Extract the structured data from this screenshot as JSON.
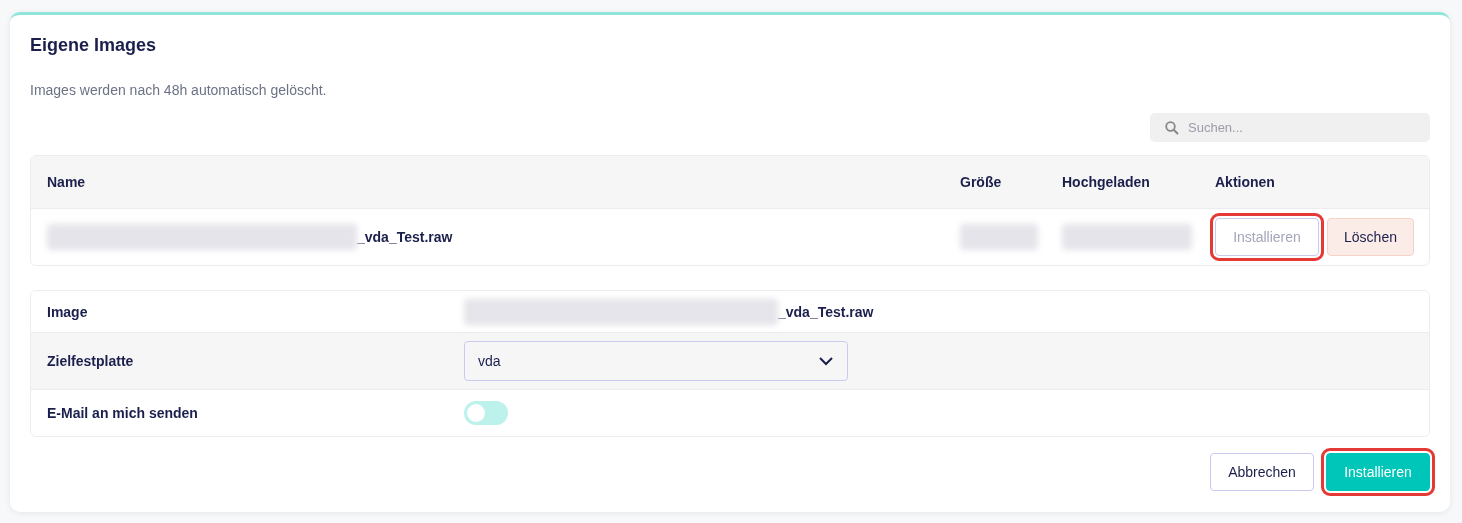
{
  "card": {
    "title": "Eigene Images",
    "note": "Images werden nach 48h automatisch gelöscht."
  },
  "search": {
    "placeholder": "Suchen..."
  },
  "table": {
    "columns": [
      "Name",
      "Größe",
      "Hochgeladen",
      "Aktionen"
    ],
    "rows": [
      {
        "name": {
          "redacted": true,
          "text": "_vda_Test.raw"
        },
        "size": {
          "redacted": true
        },
        "uploaded": {
          "redacted": true
        },
        "actions": [
          {
            "label": "Installieren",
            "kind": "outline",
            "disabled": true,
            "highlighted": true
          },
          {
            "label": "Löschen",
            "kind": "danger",
            "disabled": false,
            "highlighted": false
          }
        ]
      }
    ]
  },
  "form": [
    {
      "label": "Image",
      "kind": "text",
      "redacted": true,
      "value": "_vda_Test.raw"
    },
    {
      "label": "Zielfestplatte",
      "kind": "select",
      "value": "vda"
    },
    {
      "label": "E-Mail an mich senden",
      "kind": "toggle",
      "on": false
    }
  ],
  "footer": [
    {
      "label": "Abbrechen",
      "kind": "outline",
      "disabled": false,
      "highlighted": false
    },
    {
      "label": "Installieren",
      "kind": "primary",
      "disabled": false,
      "highlighted": true
    }
  ]
}
